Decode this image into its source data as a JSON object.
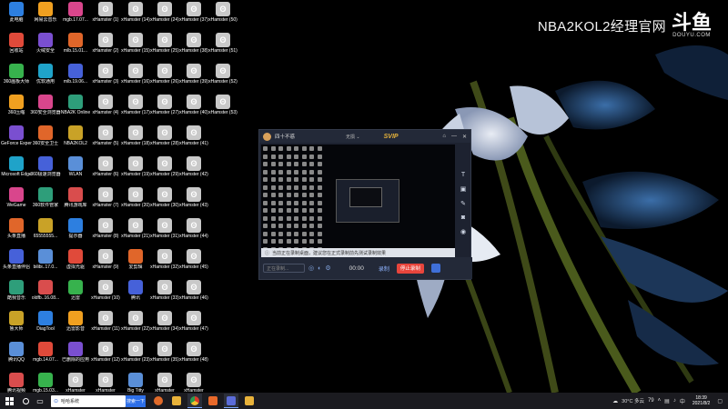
{
  "watermark": {
    "text": "NBA2KOL2经理官网",
    "logo": "斗鱼",
    "logo_sub": "DOUYU.COM"
  },
  "desktop": {
    "col1": [
      "此电脑",
      "回收站",
      "360画板大师",
      "360压缩",
      "GeForce Experience",
      "Microsoft Edge",
      "WeGame",
      "头条直播",
      "头条直播伴侣",
      "酷我音乐",
      "鲁大师",
      "腾讯QQ",
      "腾讯视频"
    ],
    "col2": [
      "网易云音乐",
      "火绒安全",
      "优软通用",
      "360安全浏览器",
      "360安全卫士",
      "360极速浏览器",
      "360软件管家",
      "65555555...",
      "bilibi..17.0...",
      "oldfb..16.08...",
      "DiagTool",
      "mgb.14.07...",
      "mgb.15.03..."
    ],
    "col3": [
      "mgb.17.07...",
      "mlb.15.01...",
      "mlb.19.06...",
      "NBA2K Online",
      "NBA2KOL2",
      "WLAN",
      "腾讯游戏库",
      "提示器",
      "虚拟光驱",
      "迅雷",
      "迅雷影音",
      "已删除的应用",
      "xHamster"
    ],
    "col4": [
      "xHamster (1)",
      "xHamster (2)",
      "xHamster (3)",
      "xHamster (4)",
      "xHamster (5)",
      "xHamster (6)",
      "xHamster (7)",
      "xHamster (8)",
      "xHamster (9)",
      "xHamster (10)",
      "xHamster (11)",
      "xHamster (12)",
      "xHamster"
    ],
    "col5": [
      "xHamster (14)",
      "xHamster (15)",
      "xHamster (16)",
      "xHamster (17)",
      "xHamster (18)",
      "xHamster (19)",
      "xHamster (20)",
      "xHamster (21)",
      "爱剪辑",
      "腾讯",
      "xHamster (22)",
      "xHamster (23)",
      "Big Titty"
    ],
    "col6": [
      "xHamster (24)",
      "xHamster (25)",
      "xHamster (26)",
      "xHamster (27)",
      "xHamster (28)",
      "xHamster (29)",
      "xHamster (30)",
      "xHamster (31)",
      "xHamster (32)",
      "xHamster (33)",
      "xHamster (34)",
      "xHamster (35)",
      "xHamster"
    ],
    "col7": [
      "xHamster (37)",
      "xHamster (38)",
      "xHamster (39)",
      "xHamster (40)",
      "xHamster (41)",
      "xHamster (42)",
      "xHamster (43)",
      "xHamster (44)",
      "xHamster (45)",
      "xHamster (46)",
      "xHamster (47)",
      "xHamster (48)",
      "xHamster"
    ],
    "col8": [
      "xHamster (50)",
      "xHamster (51)",
      "xHamster (52)",
      "xHamster (53)"
    ]
  },
  "recorder": {
    "title": "四十不惑",
    "select": "无损 ⌄",
    "svip": "SVIP",
    "tip": "当前正在录制桌面，建议您在正式录制前先测试录制效果",
    "input_placeholder": "正在录制...",
    "time": "00:00",
    "mode": "录制",
    "stop": "停止录制"
  },
  "taskbar": {
    "search_text": "哈哈系统",
    "search_button": "搜索一下",
    "weather": "30°C 多云",
    "num": "79",
    "time": "18:39",
    "date": "2021/8/2"
  }
}
